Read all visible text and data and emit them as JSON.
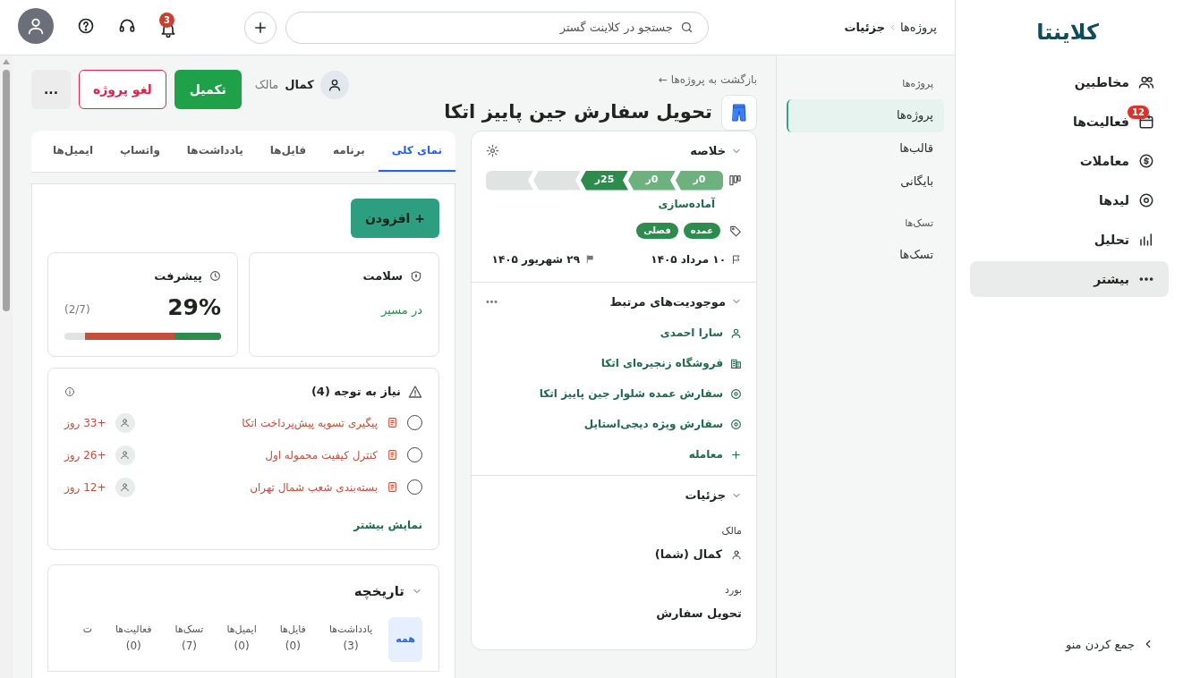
{
  "sidebar": {
    "logo": "کلاینتا",
    "items": [
      {
        "label": "مخاطبین",
        "selected": false
      },
      {
        "label": "فعالیت‌ها",
        "badge": "12",
        "selected": false
      },
      {
        "label": "معاملات",
        "selected": false
      },
      {
        "label": "لیدها",
        "selected": false
      },
      {
        "label": "تحلیل",
        "selected": false
      },
      {
        "label": "بیشتر",
        "selected": true
      }
    ],
    "collapse": "جمع کردن منو"
  },
  "topbar": {
    "breadcrumb": [
      "پروژه‌ها",
      "جزئیات"
    ],
    "search_placeholder": "جستجو در کلاینت گستر",
    "notification_badge": "3"
  },
  "subnav": {
    "sections": [
      {
        "heading": "پروژه‌ها",
        "items": [
          {
            "label": "پروژه‌ها",
            "selected": true
          },
          {
            "label": "قالب‌ها",
            "selected": false
          },
          {
            "label": "بایگانی",
            "selected": false
          }
        ]
      },
      {
        "heading": "تسک‌ها",
        "items": [
          {
            "label": "تسک‌ها",
            "selected": false
          }
        ]
      }
    ]
  },
  "header": {
    "back_link": "بازگشت به پروژه‌ها ←",
    "title": "تحویل سفارش جین پاییز اتکا",
    "owner": {
      "name": "کمال",
      "role": "مالک"
    },
    "buttons": [
      {
        "label": "تکمیل",
        "kind": "primary"
      },
      {
        "label": "لغو پروژه",
        "kind": "danger"
      },
      {
        "label": "...",
        "kind": "more"
      }
    ]
  },
  "summary": {
    "title": "خلاصه",
    "stages": [
      {
        "value": "0ر",
        "color": "#6db17f"
      },
      {
        "value": "0ر",
        "color": "#6db17f"
      },
      {
        "value": "25ر",
        "color": "#2e8b4e"
      },
      {
        "color": "#dfe4e2"
      },
      {
        "color": "#dfe4e2"
      }
    ],
    "stage_name": "آماده‌سازی",
    "tags": [
      "عمده",
      "فصلی"
    ],
    "start_date": "۱۰ مرداد ۱۴۰۵",
    "end_date": "۲۹ شهریور ۱۴۰۵"
  },
  "related": {
    "title": "موجودیت‌های مرتبط",
    "items": [
      {
        "label": "سارا احمدی",
        "kind": "contact"
      },
      {
        "label": "فروشگاه زنجیره‌ای اتکا",
        "kind": "company"
      },
      {
        "label": "سفارش عمده شلوار جین پاییز اتکا",
        "kind": "deal"
      },
      {
        "label": "سفارش ویژه دیجی‌استایل",
        "kind": "deal"
      },
      {
        "label": "معامله",
        "kind": "add"
      }
    ]
  },
  "details": {
    "title": "جزئیات",
    "fields": [
      {
        "label": "مالک",
        "value": "کمال (شما)",
        "kind": "person"
      },
      {
        "label": "بورد",
        "value": "تحویل سفارش",
        "kind": "text"
      }
    ]
  },
  "tabs": [
    {
      "label": "نمای کلی",
      "selected": true
    },
    {
      "label": "برنامه",
      "selected": false
    },
    {
      "label": "فایل‌ها",
      "selected": false
    },
    {
      "label": "یادداشت‌ها",
      "selected": false
    },
    {
      "label": "واتساپ",
      "selected": false
    },
    {
      "label": "ایمیل‌ها",
      "selected": false
    }
  ],
  "add_button": "+ افزودن",
  "health": {
    "title": "سلامت",
    "status": "در مسیر"
  },
  "progress": {
    "title": "پیشرفت",
    "value": "29%",
    "count": "(2/7)",
    "segments": [
      {
        "color": "#c44f3d",
        "level": 0.87
      },
      {
        "color": "#2e8b4e",
        "level": 0.3
      }
    ]
  },
  "attention": {
    "title": "نیاز به توجه (4)",
    "items": [
      {
        "title": "پیگیری تسویه پیش‌پرداخت اتکا",
        "due": "+33 روز",
        "checked": false
      },
      {
        "title": "کنترل کیفیت محموله اول",
        "due": "+26 روز",
        "checked": false
      },
      {
        "title": "بسته‌بندی شعب شمال تهران",
        "due": "+12 روز",
        "checked": false
      }
    ],
    "more": "نمایش بیشتر"
  },
  "history": {
    "title": "تاریخچه",
    "tabs": [
      {
        "label": "همه",
        "selected": true
      },
      {
        "label": "یادداشت‌ها",
        "count": "(3)",
        "selected": false
      },
      {
        "label": "فایل‌ها",
        "count": "(0)",
        "selected": false
      },
      {
        "label": "ایمیل‌ها",
        "count": "(0)",
        "selected": false
      },
      {
        "label": "تسک‌ها",
        "count": "(7)",
        "selected": false
      },
      {
        "label": "فعالیت‌ها",
        "count": "(0)",
        "selected": false
      },
      {
        "label": "ت",
        "selected": false
      }
    ]
  }
}
